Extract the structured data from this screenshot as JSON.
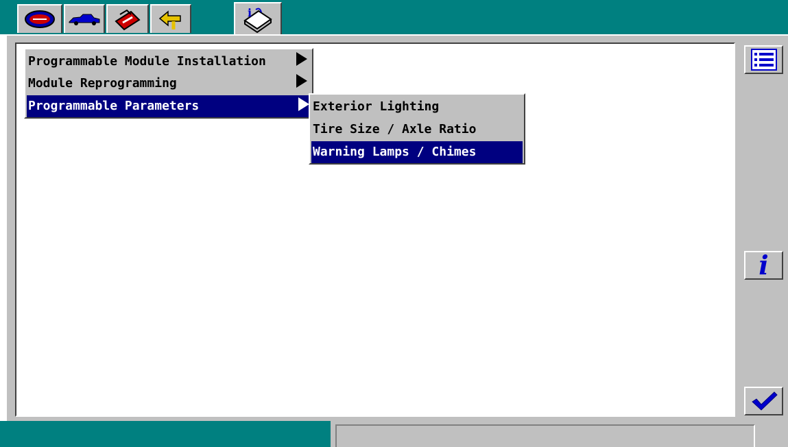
{
  "toolbar": {
    "tabs": [
      {
        "icon": "logo-badge-icon"
      },
      {
        "icon": "vehicle-icon"
      },
      {
        "icon": "toolbox-icon"
      },
      {
        "icon": "exit-arrow-icon"
      },
      {
        "icon": "info-book-icon",
        "icon_text": "i"
      }
    ]
  },
  "menu": {
    "items": [
      {
        "label": "Programmable Module Installation"
      },
      {
        "label": "Module Reprogramming"
      },
      {
        "label": "Programmable Parameters"
      }
    ]
  },
  "submenu": {
    "items": [
      {
        "label": "Exterior Lighting"
      },
      {
        "label": "Tire Size / Axle Ratio"
      },
      {
        "label": "Warning Lamps / Chimes"
      }
    ]
  },
  "sidebar": {
    "list_button": {
      "icon": "list-icon"
    },
    "info_button": {
      "icon": "info-icon",
      "text": "i"
    },
    "ok_button": {
      "icon": "checkmark-icon"
    }
  },
  "status": {
    "text": ""
  },
  "colors": {
    "teal": "#008080",
    "selection": "#000080",
    "panel": "#c0c0c0",
    "accent_blue": "#0000cc"
  }
}
